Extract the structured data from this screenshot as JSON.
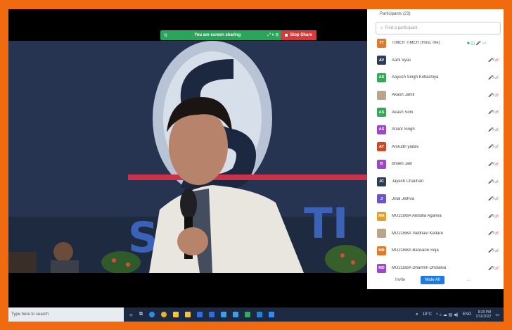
{
  "share_toolbar": {
    "status": "You are screen sharing",
    "stop_label": "Stop Share"
  },
  "participants_panel": {
    "title": "Participants (23)",
    "search_placeholder": "Find a participant",
    "participants": [
      {
        "initials": "TT",
        "name": "TIMER TIMER (Host, me)",
        "color": "#e07a2a",
        "host": true
      },
      {
        "initials": "AV",
        "name": "Aarti Vyas",
        "color": "#2d3d55"
      },
      {
        "initials": "AS",
        "name": "Aayush Singh Kotlashiya",
        "color": "#3aa65c"
      },
      {
        "initials": "",
        "name": "Akash Jamil",
        "color": "#b9a58c",
        "photo": true
      },
      {
        "initials": "AS",
        "name": "Akash Soni",
        "color": "#3aa65c"
      },
      {
        "initials": "AS",
        "name": "Anant Singh",
        "color": "#9a4bc4"
      },
      {
        "initials": "AY",
        "name": "Anirudh yadav",
        "color": "#c94a2a"
      },
      {
        "initials": "B",
        "name": "Bhakti Jain",
        "color": "#9a4bc4"
      },
      {
        "initials": "JC",
        "name": "Jayesh Chauhan",
        "color": "#2d3d55"
      },
      {
        "initials": "J",
        "name": "Jinal Jethva",
        "color": "#6a56c4"
      },
      {
        "initials": "MA",
        "name": "MU21BBA Abdulla Agarwa",
        "color": "#e0a02a"
      },
      {
        "initials": "",
        "name": "MU21BBA Vaibhavi Kedare",
        "color": "#b9a58c",
        "photo": true
      },
      {
        "initials": "MB",
        "name": "MU21BBA Bansarie Soja",
        "color": "#e07a2a"
      },
      {
        "initials": "MD",
        "name": "MU21BBA Dharmin Dholakia",
        "color": "#9a4bc4"
      }
    ],
    "invite_label": "Invite",
    "mute_all_label": "Mute All",
    "more_label": "..."
  },
  "taskbar": {
    "search_placeholder": "Type here to search",
    "weather": "18°C",
    "lang": "ENG",
    "time": "8:29 PM",
    "date": "1/11/2022"
  }
}
